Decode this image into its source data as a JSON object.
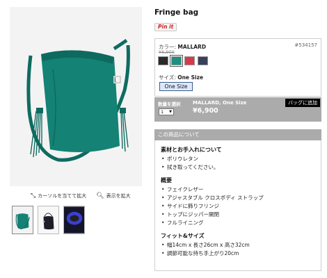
{
  "product": {
    "title": "Fringe bag",
    "pinit_label": "Pin it"
  },
  "options": {
    "color_label": "カラー:",
    "color_value": "MALLARD",
    "sku": "#534157",
    "old_price": "¥6,900",
    "swatches": [
      {
        "name": "black",
        "color": "#2a2a2a"
      },
      {
        "name": "mallard",
        "color": "#1f8f7f",
        "selected": true
      },
      {
        "name": "red",
        "color": "#d63a4a"
      },
      {
        "name": "navy",
        "color": "#3a3f5a"
      }
    ],
    "size_label": "サイズ:",
    "size_value": "One Size",
    "size_button": "One Size"
  },
  "buy": {
    "qty_label": "数量を選択",
    "qty_value": "1",
    "variant": "MALLARD, One Size",
    "price": "¥6,900",
    "add_to_bag": "バッグに追加"
  },
  "zoom": {
    "hover_zoom": "カーソルを当てて拡大",
    "show_zoom": "表示を拡大"
  },
  "thumbnails": [
    {
      "name": "front-teal"
    },
    {
      "name": "black-bag"
    },
    {
      "name": "inside-blue"
    }
  ],
  "about": {
    "header": "この商品について",
    "sections": [
      {
        "title": "素材とお手入れについて",
        "items": [
          "ポリウレタン",
          "拭き取ってください。"
        ]
      },
      {
        "title": "概要",
        "items": [
          "フェイクレザー",
          "アジャスタブル クロスボディ ストラップ",
          "サイドに飾りフリンジ",
          "トップにジッパー開閉",
          "フルライニング"
        ]
      },
      {
        "title": "フィット&サイズ",
        "items": [
          "幅14cm x 長さ26cm x 高さ32cm",
          "調節可能な持ち手上がり20cm"
        ]
      }
    ]
  }
}
